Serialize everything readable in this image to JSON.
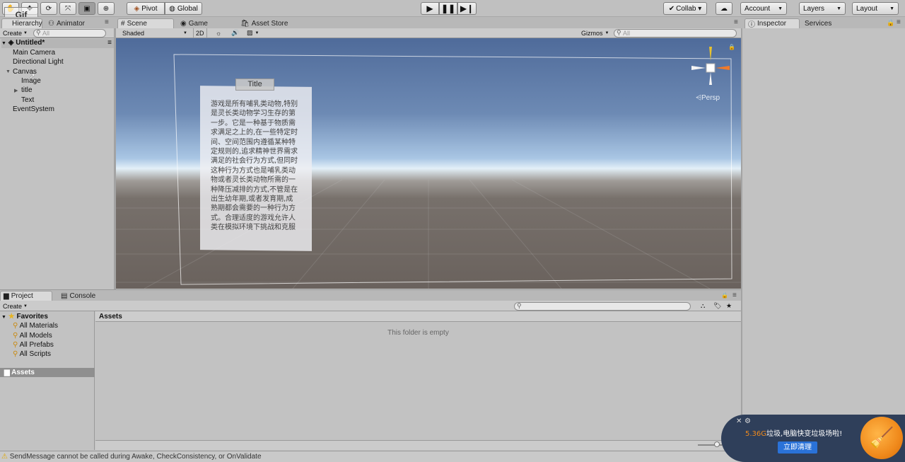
{
  "toolbar": {
    "pivot": "Pivot",
    "global": "Global",
    "collab": "Collab ▾",
    "account": "Account",
    "layers": "Layers",
    "layout": "Layout"
  },
  "watermark": "Gif",
  "hierarchy": {
    "tab": "Hierarchy",
    "create": "Create",
    "search_placeholder": "All",
    "scene": "Untitled*",
    "items": [
      "Main Camera",
      "Directional Light",
      "Canvas",
      "Image",
      "title",
      "Text",
      "EventSystem"
    ]
  },
  "tabs": {
    "animator": "Animator",
    "scene": "Scene",
    "game": "Game",
    "asset_store": "Asset Store",
    "inspector": "Inspector",
    "services": "Services",
    "project": "Project",
    "console": "Console"
  },
  "scene_toolbar": {
    "shading": "Shaded",
    "mode2d": "2D",
    "gizmos": "Gizmos",
    "search_placeholder": "All",
    "persp": "Persp"
  },
  "ui_panel": {
    "title": "Title",
    "text": "游戏是所有哺乳类动物,特别是灵长类动物学习生存的第一步。它是一种基于物质需求满足之上的,在一些特定时间、空间范围内遵循某种特定规则的,追求精神世界需求满足的社会行为方式,但同时这种行为方式也是哺乳类动物或者灵长类动物所需的一种降压减排的方式,不管是在出生幼年期,或者发育期,成熟期都会需要的一种行为方式。合理适度的游戏允许人类在模拟环境下挑战和克服"
  },
  "project": {
    "create": "Create",
    "favorites": "Favorites",
    "favorite_items": [
      "All Materials",
      "All Models",
      "All Prefabs",
      "All Scripts"
    ],
    "assets": "Assets",
    "assets_header": "Assets",
    "empty": "This folder is empty"
  },
  "status": {
    "message": "SendMessage cannot be called during Awake, CheckConsistency, or OnValidate"
  },
  "popup": {
    "size": "5.36G",
    "text": "垃圾,电脑快变垃圾场啦!",
    "button": "立即清理"
  },
  "colors": {
    "sky_top": "#4d6a9a",
    "sky_horizon": "#d8eaf6",
    "ground": "#6a625d",
    "popup_bg": "#2f3f5a",
    "popup_accent": "#f08a1c",
    "popup_button": "#2a72d8"
  }
}
